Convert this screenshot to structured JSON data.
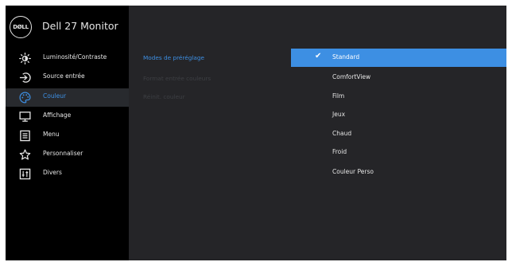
{
  "brand": {
    "logo_text": "DØLL",
    "model": "Dell 27 Monitor"
  },
  "sidebar": {
    "items": [
      {
        "label": "Luminosité/Contraste",
        "icon": "brightness-icon"
      },
      {
        "label": "Source entrée",
        "icon": "input-source-icon"
      },
      {
        "label": "Couleur",
        "icon": "palette-icon",
        "active": true
      },
      {
        "label": "Affichage",
        "icon": "display-icon"
      },
      {
        "label": "Menu",
        "icon": "menu-icon"
      },
      {
        "label": "Personnaliser",
        "icon": "star-icon"
      },
      {
        "label": "Divers",
        "icon": "sliders-icon"
      }
    ]
  },
  "submenu": {
    "items": [
      {
        "label": "Modes de préréglage",
        "state": "active"
      },
      {
        "label": "Format entrée couleurs",
        "state": "disabled"
      },
      {
        "label": "Réinit. couleur",
        "state": "disabled"
      }
    ]
  },
  "options": {
    "items": [
      {
        "label": "Standard",
        "selected": true
      },
      {
        "label": "ComfortView"
      },
      {
        "label": "Film"
      },
      {
        "label": "Jeux"
      },
      {
        "label": "Chaud"
      },
      {
        "label": "Froid"
      },
      {
        "label": "Couleur Perso"
      }
    ],
    "check_glyph": "✔"
  },
  "colors": {
    "accent": "#3d8fe3",
    "sidebar_bg": "#000000",
    "panel_bg": "#252528",
    "text": "#e6e6e6",
    "disabled_text": "#3d3f43"
  }
}
